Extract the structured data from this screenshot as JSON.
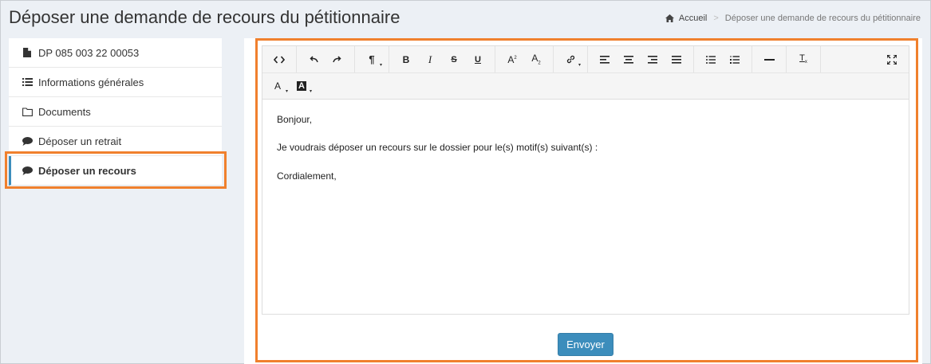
{
  "header": {
    "title": "Déposer une demande de recours du pétitionnaire",
    "breadcrumb": {
      "home": "Accueil",
      "current": "Déposer une demande de recours du pétitionnaire"
    }
  },
  "sidebar": {
    "items": [
      {
        "label": "DP 085 003 22 00053",
        "icon": "file-icon"
      },
      {
        "label": "Informations générales",
        "icon": "list-icon"
      },
      {
        "label": "Documents",
        "icon": "folder-icon"
      },
      {
        "label": "Déposer un retrait",
        "icon": "comment-icon"
      },
      {
        "label": "Déposer un recours",
        "icon": "comment-icon",
        "active": true
      }
    ]
  },
  "editor": {
    "toolbar_row1": [
      "code-view",
      "undo",
      "redo",
      "paragraph",
      "bold",
      "italic",
      "strikethrough",
      "underline",
      "superscript",
      "subscript",
      "link",
      "align-left",
      "align-center",
      "align-right",
      "align-justify",
      "bullet-list",
      "numbered-list",
      "horizontal-rule",
      "clear-format",
      "fullscreen"
    ],
    "toolbar_row2": [
      "text-color",
      "background-color"
    ],
    "content": {
      "line1": "Bonjour,",
      "line2": "Je voudrais déposer un recours sur le dossier pour le(s) motif(s) suivant(s) :",
      "line3": "Cordialement,"
    }
  },
  "actions": {
    "send_label": "Envoyer"
  },
  "colors": {
    "accent": "#3c8dbc",
    "highlight": "#f0802d",
    "background": "#ecf0f5"
  }
}
